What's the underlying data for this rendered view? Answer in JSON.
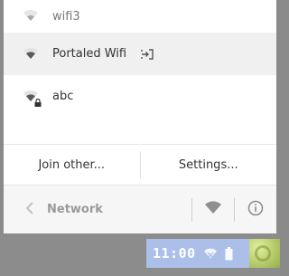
{
  "networks": [
    {
      "name": "wifi3",
      "secured": false,
      "selected": false,
      "portal": false
    },
    {
      "name": "Portaled Wifi",
      "secured": false,
      "selected": true,
      "portal": true,
      "portal_icon": "portal-sign-in-icon"
    },
    {
      "name": "abc",
      "secured": true,
      "selected": false,
      "portal": false
    }
  ],
  "actions": {
    "join_other": "Join other...",
    "settings": "Settings..."
  },
  "footer": {
    "title": "Network",
    "back_icon": "chevron-left-icon",
    "wifi_icon": "wifi-icon",
    "info_icon": "info-icon"
  },
  "tray": {
    "time": "11:00",
    "icons": [
      "wifi-icon",
      "battery-icon",
      "avatar"
    ]
  },
  "colors": {
    "selected_row": "#f0f0f0",
    "footer_bg": "#f6f6f6",
    "tray_bg": "#abbfe9"
  }
}
